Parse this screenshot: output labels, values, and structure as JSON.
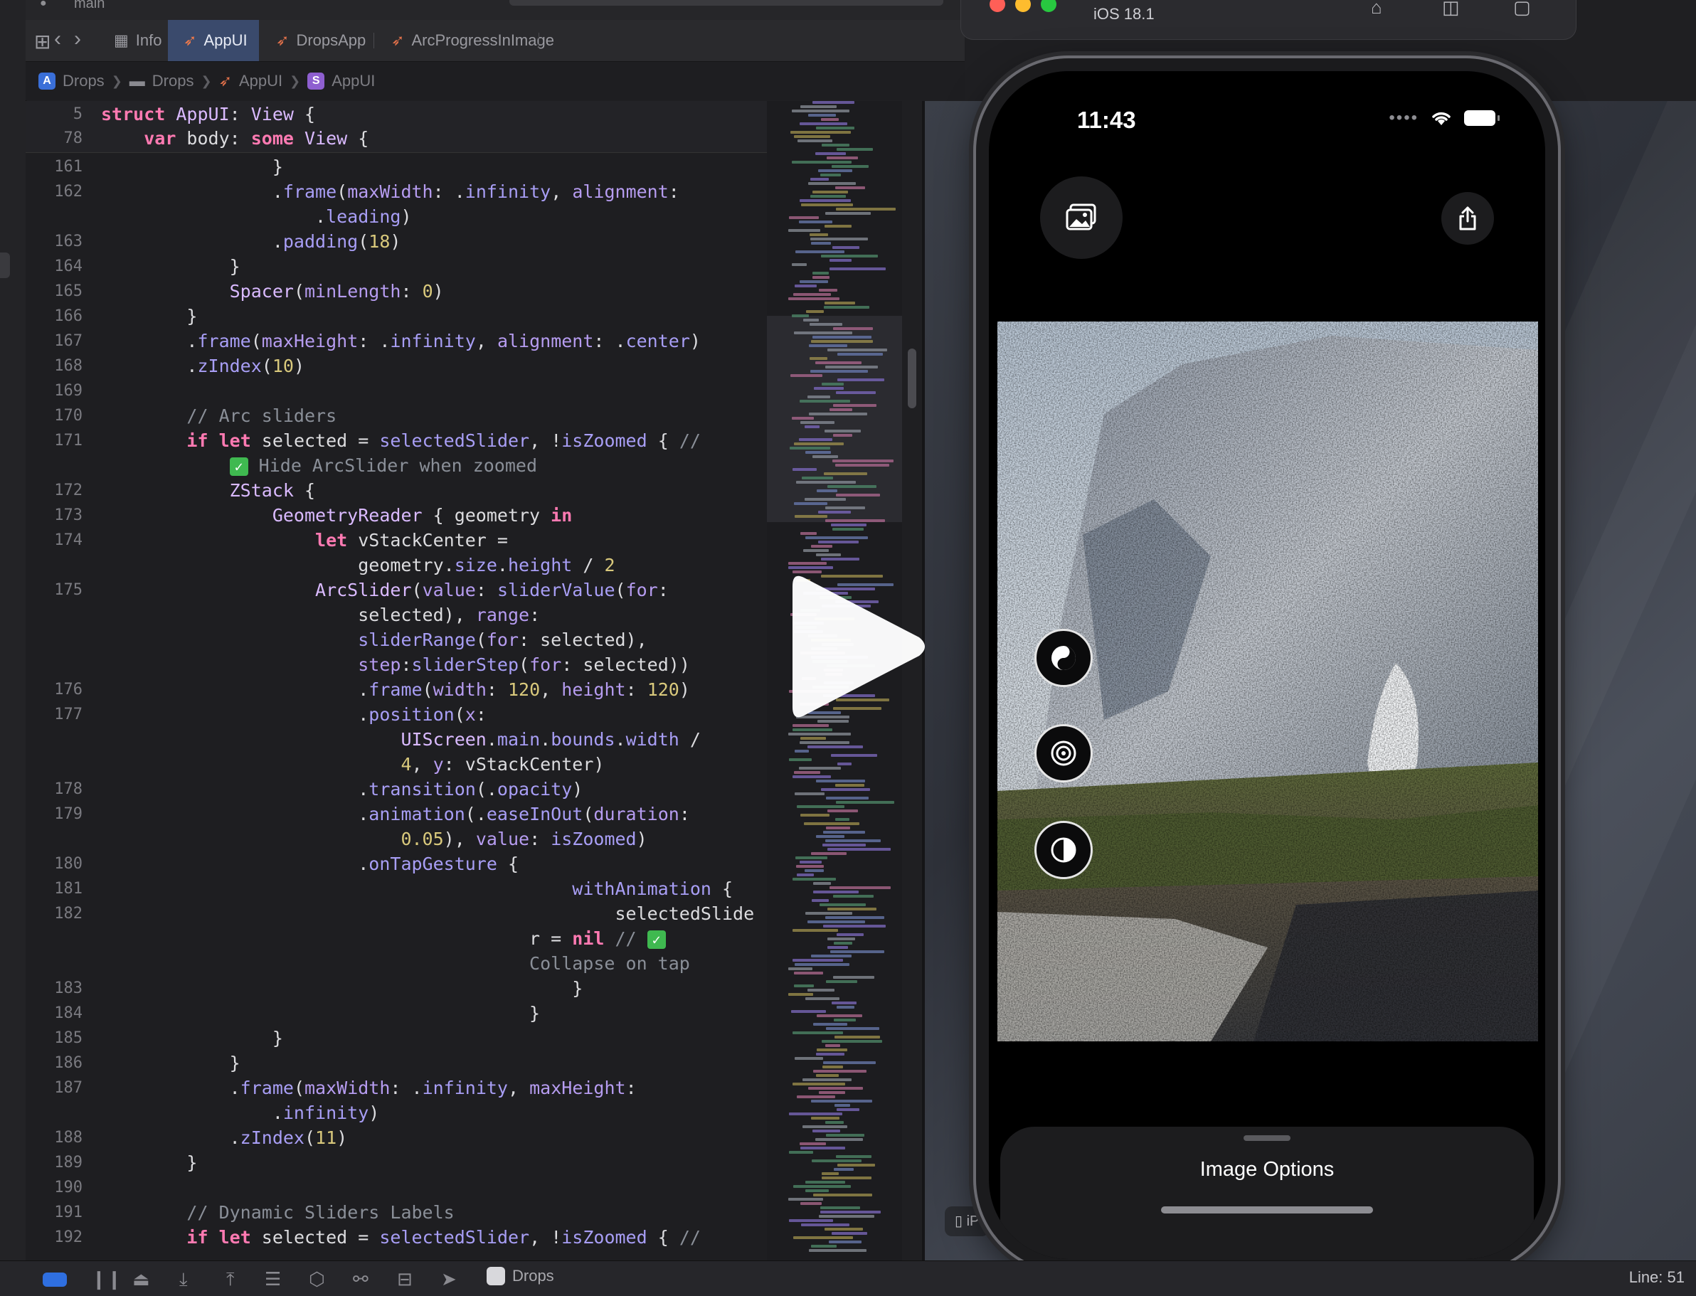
{
  "top": {
    "branch": "main"
  },
  "tabs": [
    {
      "label": "Info",
      "icon": "table-icon"
    },
    {
      "label": "AppUI",
      "icon": "swift-icon",
      "active": true
    },
    {
      "label": "DropsApp",
      "icon": "swift-icon"
    },
    {
      "label": "ArcProgressInImage",
      "icon": "swift-icon"
    }
  ],
  "breadcrumb": [
    "Drops",
    "Drops",
    "AppUI",
    "AppUI"
  ],
  "code": {
    "sticky": [
      {
        "n": "5",
        "text": "struct AppUI: View {"
      },
      {
        "n": "78",
        "text": "    var body: some View {"
      }
    ],
    "lines": [
      {
        "n": "161",
        "text": "                }"
      },
      {
        "n": "162",
        "text": "                .frame(maxWidth: .infinity, alignment:"
      },
      {
        "n": "",
        "text": "                    .leading)"
      },
      {
        "n": "163",
        "text": "                .padding(18)"
      },
      {
        "n": "164",
        "text": "            }"
      },
      {
        "n": "165",
        "text": "            Spacer(minLength: 0)"
      },
      {
        "n": "166",
        "text": "        }"
      },
      {
        "n": "167",
        "text": "        .frame(maxHeight: .infinity, alignment: .center)"
      },
      {
        "n": "168",
        "text": "        .zIndex(10)"
      },
      {
        "n": "169",
        "text": ""
      },
      {
        "n": "170",
        "text": "        // Arc sliders"
      },
      {
        "n": "171",
        "text": "        if let selected = selectedSlider, !isZoomed { //"
      },
      {
        "n": "",
        "text": "            ✅ Hide ArcSlider when zoomed"
      },
      {
        "n": "172",
        "text": "            ZStack {"
      },
      {
        "n": "173",
        "text": "                GeometryReader { geometry in"
      },
      {
        "n": "174",
        "text": "                    let vStackCenter ="
      },
      {
        "n": "",
        "text": "                        geometry.size.height / 2"
      },
      {
        "n": "175",
        "text": "                    ArcSlider(value: sliderValue(for:"
      },
      {
        "n": "",
        "text": "                        selected), range:"
      },
      {
        "n": "",
        "text": "                        sliderRange(for: selected),"
      },
      {
        "n": "",
        "text": "                        step:sliderStep(for: selected))"
      },
      {
        "n": "176",
        "text": "                        .frame(width: 120, height: 120)"
      },
      {
        "n": "177",
        "text": "                        .position(x:"
      },
      {
        "n": "",
        "text": "                            UIScreen.main.bounds.width /"
      },
      {
        "n": "",
        "text": "                            4, y: vStackCenter)"
      },
      {
        "n": "178",
        "text": "                        .transition(.opacity)"
      },
      {
        "n": "179",
        "text": "                        .animation(.easeInOut(duration:"
      },
      {
        "n": "",
        "text": "                            0.05), value: isZoomed)"
      },
      {
        "n": "180",
        "text": "                        .onTapGesture {"
      },
      {
        "n": "181",
        "text": "                                            withAnimation {"
      },
      {
        "n": "182",
        "text": "                                                selectedSlide"
      },
      {
        "n": "",
        "text": "                                        r = nil // ✅"
      },
      {
        "n": "",
        "text": "                                        Collapse on tap"
      },
      {
        "n": "183",
        "text": "                                            }"
      },
      {
        "n": "184",
        "text": "                                        }"
      },
      {
        "n": "185",
        "text": "                }"
      },
      {
        "n": "186",
        "text": "            }"
      },
      {
        "n": "187",
        "text": "            .frame(maxWidth: .infinity, maxHeight:"
      },
      {
        "n": "",
        "text": "                .infinity)"
      },
      {
        "n": "188",
        "text": "            .zIndex(11)"
      },
      {
        "n": "189",
        "text": "        }"
      },
      {
        "n": "190",
        "text": ""
      },
      {
        "n": "191",
        "text": "        // Dynamic Sliders Labels"
      },
      {
        "n": "192",
        "text": "        if let selected = selectedSlider, !isZoomed { //"
      }
    ]
  },
  "simulator": {
    "title": "iOS 18.1",
    "device_chip": "iP",
    "status_time": "11:43",
    "sheet_title": "Image Options"
  },
  "statusbar": {
    "scheme": "Drops",
    "line": "Line: 51"
  },
  "colors": {
    "accent": "#2f6fe0",
    "tab_active": "#3a4a6c",
    "keyword": "#ff7ab2",
    "type": "#dabaff",
    "number": "#d9c97c",
    "comment": "#8a8f98"
  }
}
